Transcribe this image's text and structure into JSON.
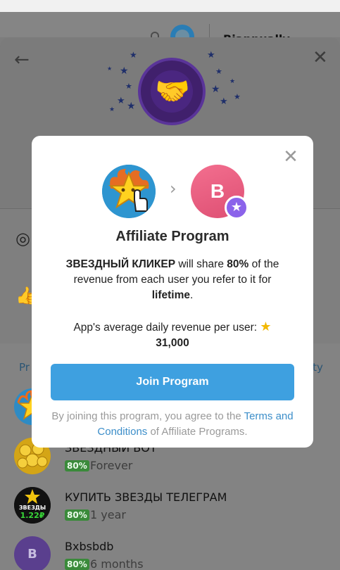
{
  "background": {
    "header_right_text": "Biannually",
    "tab_left": "Pr",
    "tab_right": "ity"
  },
  "apps": [
    {
      "name": "",
      "badge": "",
      "duration": ""
    },
    {
      "name": "ЗВЕЗДНЫЙ БОТ",
      "badge": "80%",
      "duration": "Forever"
    },
    {
      "name": "КУПИТЬ ЗВЕЗДЫ ТЕЛЕГРАМ",
      "badge": "80%",
      "duration": "1 year",
      "avatar_text_1": "ЗВЕЗДЫ",
      "avatar_text_2": "1.22₽"
    },
    {
      "name": "Bxbsbdb",
      "badge": "80%",
      "duration": "6 months",
      "avatar_letter": "B"
    }
  ],
  "modal": {
    "user_avatar_letter": "B",
    "title": "Affiliate Program",
    "desc_bot": "ЗВЕЗДНЫЙ КЛИКЕР",
    "desc_mid": " will share ",
    "desc_pct": "80%",
    "desc_rest": " of the revenue from each user you refer to it for ",
    "desc_life": "lifetime",
    "desc_end": ".",
    "revenue_label": "App's average daily revenue per user:",
    "revenue_value": "31,000",
    "join_label": "Join Program",
    "legal_pre": "By joining this program, you agree to the ",
    "legal_link": "Terms and Conditions",
    "legal_post": " of Affiliate Programs."
  },
  "colors": {
    "accent": "#3ea0e0",
    "link": "#3c8ec9",
    "badge_green": "#3a8a3a",
    "premium": "#8b63ea"
  }
}
